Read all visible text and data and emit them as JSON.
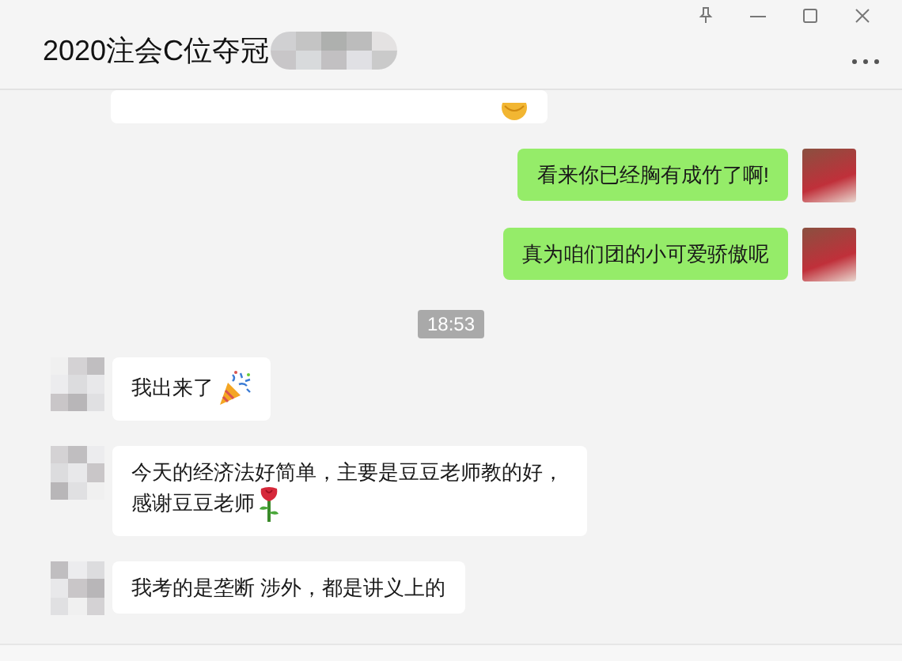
{
  "window": {
    "title": "2020注会C位夺冠"
  },
  "messages": [
    {
      "kind": "cut",
      "icon": true
    },
    {
      "kind": "out",
      "text": "看来你已经胸有成竹了啊!",
      "icon": false
    },
    {
      "kind": "out",
      "text": "真为咱们团的小可爱骄傲呢",
      "icon": false
    },
    {
      "kind": "time",
      "text": "18:53"
    },
    {
      "kind": "in",
      "text": "我出来了",
      "icon": true
    },
    {
      "kind": "in",
      "text": "今天的经济法好简单，主要是豆豆老师教的好，感谢豆豆老师",
      "icon": true
    },
    {
      "kind": "in",
      "text": "我考的是垄断 涉外，都是讲义上的",
      "icon": false
    }
  ]
}
